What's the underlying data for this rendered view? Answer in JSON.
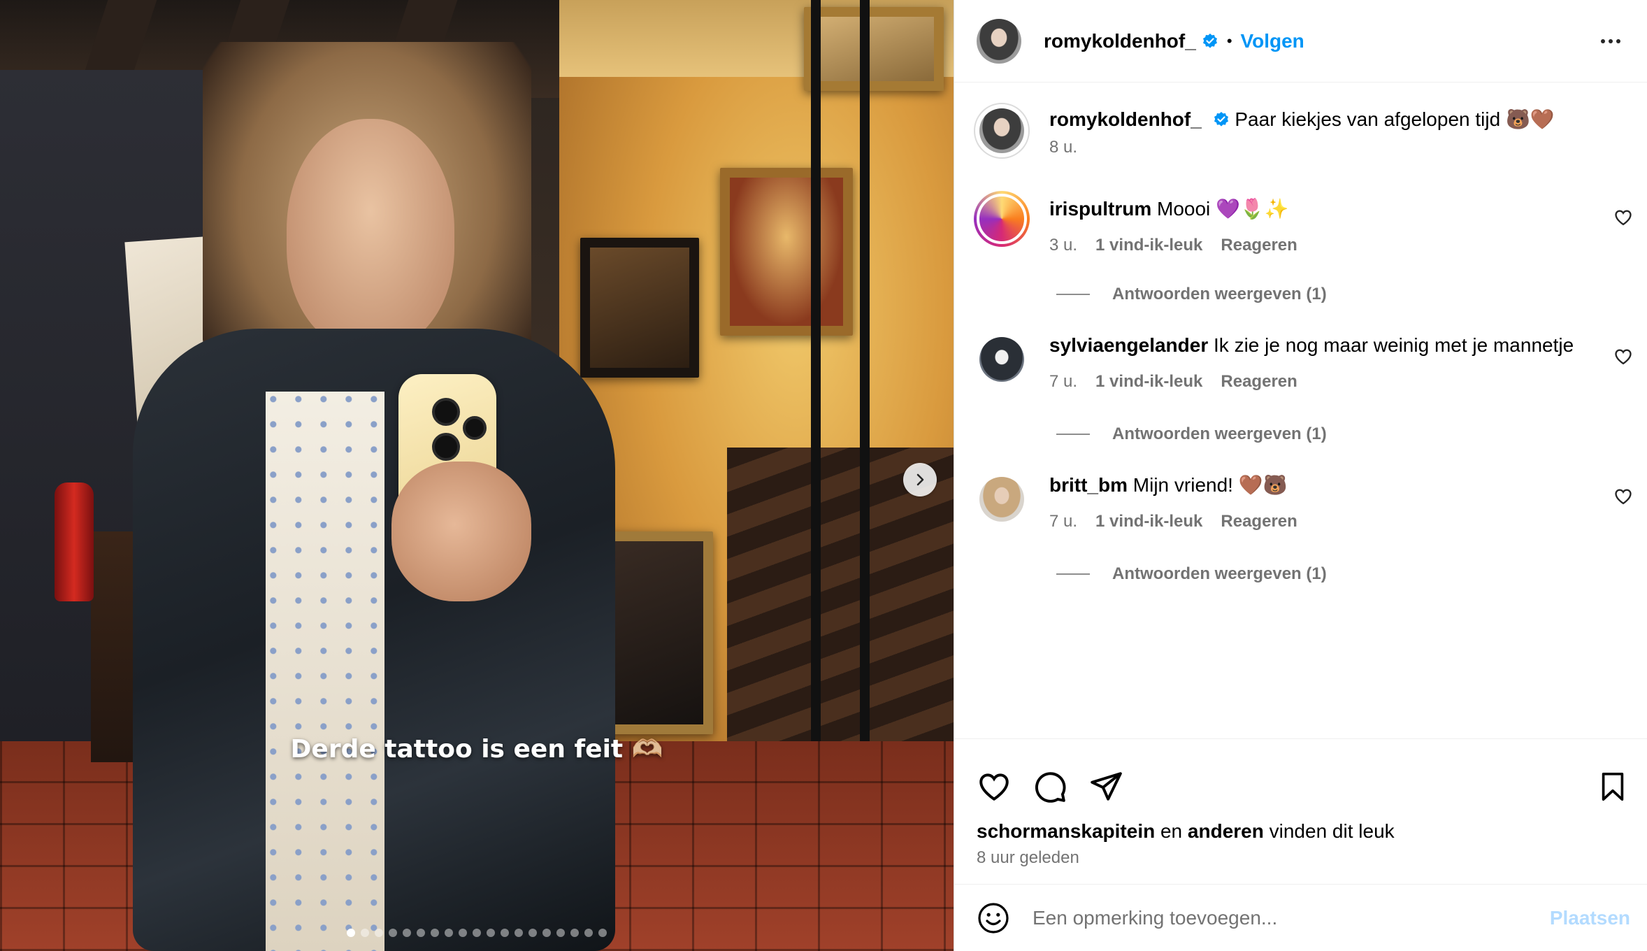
{
  "media": {
    "overlay_caption": "Derde tattoo is een feit 🫶🏼",
    "slide_count": 19,
    "active_slide": 1
  },
  "header": {
    "username": "romykoldenhof_",
    "separator": "•",
    "follow_label": "Volgen"
  },
  "caption": {
    "username": "romykoldenhof_",
    "text": "Paar kiekjes van afgelopen tijd 🐻🤎",
    "time": "8 u."
  },
  "comments": [
    {
      "username": "irispultrum",
      "text": "Moooi 💜🌷✨",
      "time": "3 u.",
      "likes": "1 vind-ik-leuk",
      "reply": "Reageren",
      "view_replies": "Antwoorden weergeven (1)"
    },
    {
      "username": "sylviaengelander",
      "text": "Ik zie je nog maar weinig met je mannetje",
      "time": "7 u.",
      "likes": "1 vind-ik-leuk",
      "reply": "Reageren",
      "view_replies": "Antwoorden weergeven (1)"
    },
    {
      "username": "britt_bm",
      "text": "Mijn vriend! 🤎🐻",
      "time": "7 u.",
      "likes": "1 vind-ik-leuk",
      "reply": "Reageren",
      "view_replies": "Antwoorden weergeven (1)"
    }
  ],
  "likes_line": {
    "user": "schormanskapitein",
    "connector": "en",
    "others": "anderen",
    "suffix": "vinden dit leuk"
  },
  "post_time": "8 uur geleden",
  "comment_box": {
    "placeholder": "Een opmerking toevoegen...",
    "post_label": "Plaatsen"
  },
  "colors": {
    "accent": "#0095f6",
    "verified": "#0095f6",
    "post_disabled": "#b3dbff",
    "secondary_text": "#737373"
  },
  "icons": [
    "heart-icon",
    "comment-icon",
    "share-icon",
    "bookmark-icon",
    "emoji-icon",
    "more-icon",
    "chevron-right-icon",
    "verified-badge-icon"
  ]
}
